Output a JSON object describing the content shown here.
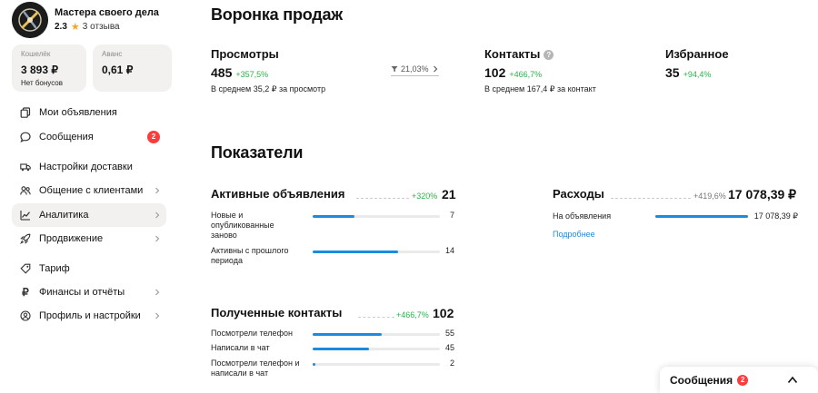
{
  "profile": {
    "name": "Мастера своего дела",
    "rating": "2.3",
    "reviews": "3 отзыва"
  },
  "wallets": [
    {
      "label": "Кошелёк",
      "value": "3 893 ₽",
      "sub": "Нет бонусов"
    },
    {
      "label": "Аванс",
      "value": "0,61 ₽",
      "sub": ""
    }
  ],
  "menu": [
    {
      "label": "Мои объявления",
      "icon": "copy-icon",
      "chevron": false,
      "badge": ""
    },
    {
      "label": "Сообщения",
      "icon": "chat-bubble-icon",
      "chevron": false,
      "badge": "2"
    },
    {
      "label": "Настройки доставки",
      "icon": "truck-icon",
      "chevron": false,
      "badge": ""
    },
    {
      "label": "Общение с клиентами",
      "icon": "people-icon",
      "chevron": true,
      "badge": ""
    },
    {
      "label": "Аналитика",
      "icon": "chart-icon",
      "chevron": true,
      "badge": "",
      "active": true
    },
    {
      "label": "Продвижение",
      "icon": "rocket-icon",
      "chevron": true,
      "badge": ""
    },
    {
      "label": "Тариф",
      "icon": "tag-icon",
      "chevron": false,
      "badge": ""
    },
    {
      "label": "Финансы и отчёты",
      "icon": "ruble-icon",
      "chevron": true,
      "badge": ""
    },
    {
      "label": "Профиль и настройки",
      "icon": "user-icon",
      "chevron": true,
      "badge": ""
    }
  ],
  "funnel": {
    "title": "Воронка продаж",
    "views": {
      "title": "Просмотры",
      "value": "485",
      "delta": "+357,5%",
      "sub": "В среднем 35,2 ₽ за просмотр"
    },
    "conversion": "21,03%",
    "contacts": {
      "title": "Контакты",
      "value": "102",
      "delta": "+466,7%",
      "sub": "В среднем 167,4 ₽ за контакт"
    },
    "favorites": {
      "title": "Избранное",
      "value": "35",
      "delta": "+94,4%"
    }
  },
  "metrics": {
    "title": "Показатели",
    "active_ads": {
      "title": "Активные объявления",
      "delta": "+320%",
      "total": "21",
      "rows": [
        {
          "label": "Новые и опубликованные заново",
          "value": "7",
          "fraction": 0.33
        },
        {
          "label": "Активны с прошлого периода",
          "value": "14",
          "fraction": 0.67
        }
      ]
    },
    "contacts": {
      "title": "Полученные контакты",
      "delta": "+466,7%",
      "total": "102",
      "rows": [
        {
          "label": "Посмотрели телефон",
          "value": "55",
          "fraction": 0.54
        },
        {
          "label": "Написали в чат",
          "value": "45",
          "fraction": 0.44
        },
        {
          "label": "Посмотрели телефон и написали в чат",
          "value": "2",
          "fraction": 0.02
        }
      ]
    },
    "expenses": {
      "title": "Расходы",
      "delta": "+419,6%",
      "total": "17 078,39 ₽",
      "rows": [
        {
          "label": "На объявления",
          "value": "17 078,39 ₽",
          "fraction": 1.0
        }
      ],
      "more_link": "Подробнее"
    }
  },
  "messages_popup": {
    "label": "Сообщения",
    "badge": "2"
  },
  "colors": {
    "accent_blue": "#1b8be0",
    "positive_green": "#2bb24c",
    "badge_red": "#ff3b3b",
    "panel_gray": "#f2f1f0"
  }
}
